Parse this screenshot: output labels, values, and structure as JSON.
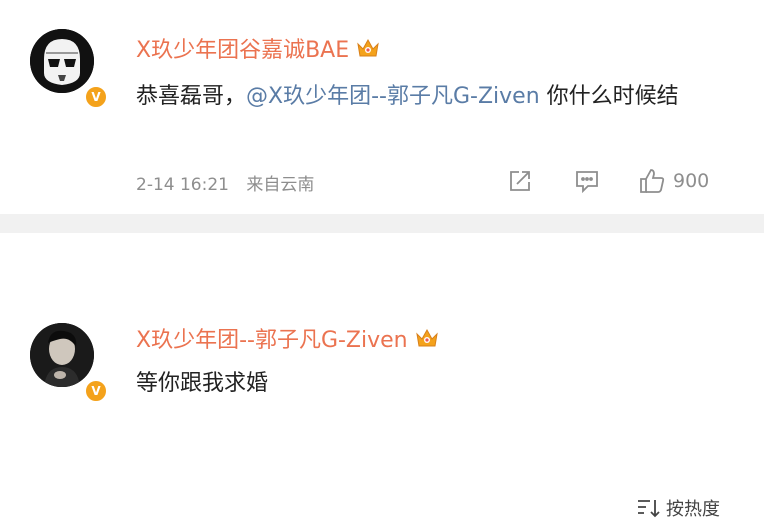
{
  "comments": [
    {
      "author": "X玖少年团谷嘉诚BAE",
      "verified_badge": "V",
      "text_before": "恭喜磊哥，",
      "mention": "@X玖少年团--郭子凡G-Ziven",
      "text_after": " 你什么时候结",
      "date": "2-14 16:21",
      "source": "来自云南",
      "likes": "900"
    },
    {
      "author": "X玖少年团--郭子凡G-Ziven",
      "verified_badge": "V",
      "text": "等你跟我求婚"
    }
  ],
  "sort": {
    "label": "按热度"
  },
  "colors": {
    "author": "#eb7350",
    "mention": "#5a7ca6",
    "meta": "#8e8e8e",
    "badge": "#f4a21b"
  },
  "icons": [
    "share-icon",
    "comment-icon",
    "like-icon",
    "sort-icon",
    "crown-icon"
  ]
}
